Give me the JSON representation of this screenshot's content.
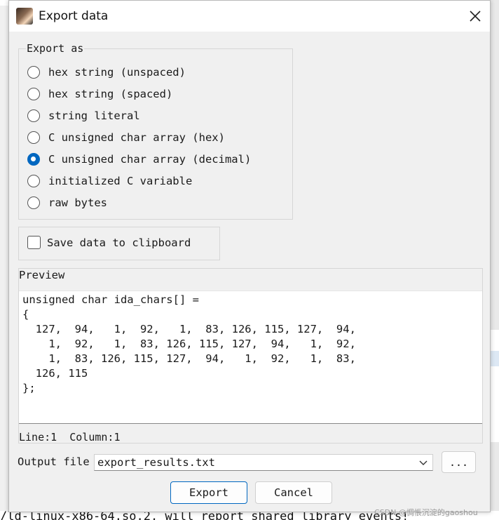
{
  "dialog": {
    "title": "Export data",
    "close_icon": "close-icon",
    "export_as": {
      "legend": "Export as",
      "options": [
        {
          "label": "hex string (unspaced)",
          "checked": false
        },
        {
          "label": "hex string (spaced)",
          "checked": false
        },
        {
          "label": "string literal",
          "checked": false
        },
        {
          "label": "C unsigned char array (hex)",
          "checked": false
        },
        {
          "label": "C unsigned char array (decimal)",
          "checked": true
        },
        {
          "label": "initialized C variable",
          "checked": false
        },
        {
          "label": "raw bytes",
          "checked": false
        }
      ]
    },
    "clipboard": {
      "label": "Save data to clipboard",
      "checked": false
    },
    "preview": {
      "label": "Preview",
      "lines": [
        "unsigned char ida_chars[] =",
        "{",
        "  127,  94,   1,  92,   1,  83, 126, 115, 127,  94,",
        "    1,  92,   1,  83, 126, 115, 127,  94,   1,  92,",
        "    1,  83, 126, 115, 127,  94,   1,  92,   1,  83,",
        "  126, 115",
        "};"
      ],
      "status": "Line:1  Column:1"
    },
    "output_file": {
      "label": "Output file",
      "value": "export_results.txt",
      "browse_label": "..."
    },
    "buttons": {
      "export": "Export",
      "cancel": "Cancel"
    }
  },
  "background": {
    "bottom_text": "/ld-linux-x86-64.so.2, will report shared library events!",
    "watermark": "CSDN @惆悵沉淀的gaoshou"
  },
  "colors": {
    "accent": "#0067c0",
    "dialog_bg": "#f0f0f0"
  }
}
